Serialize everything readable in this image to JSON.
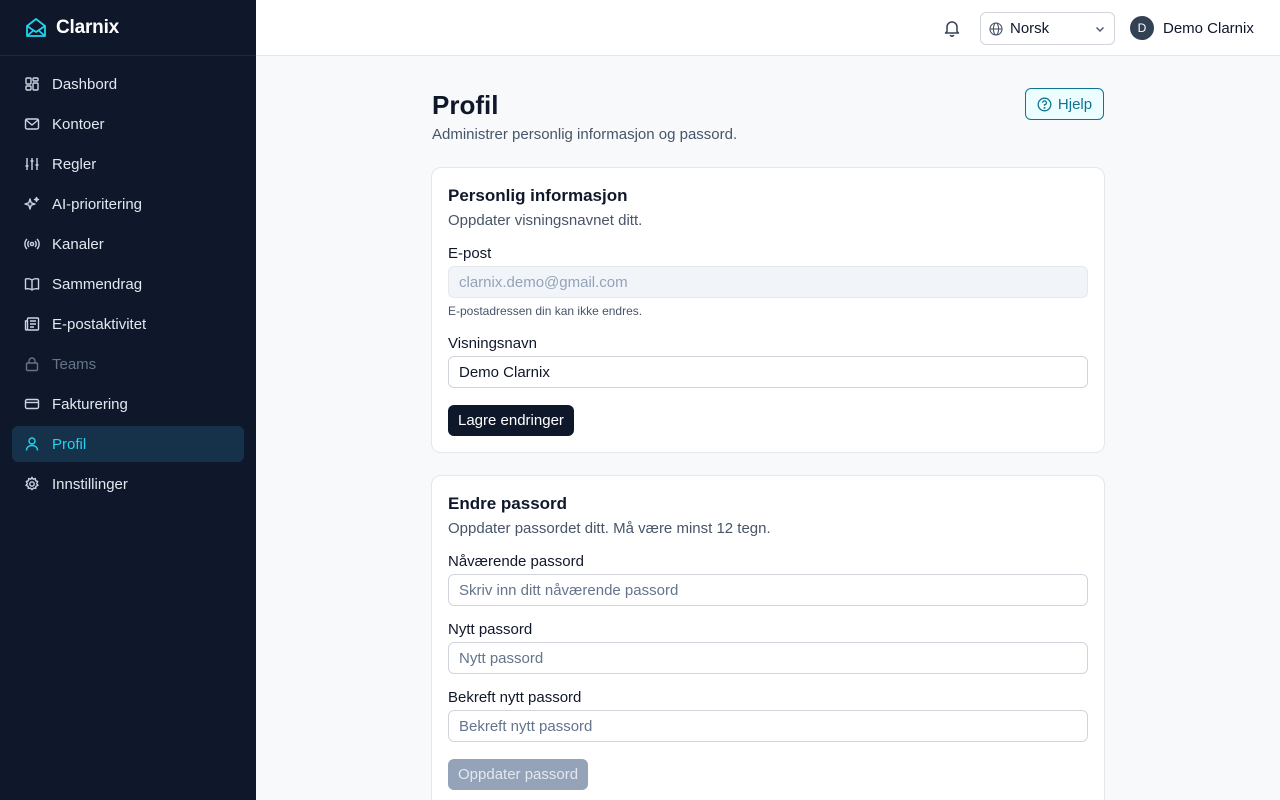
{
  "app": {
    "name": "Clarnix"
  },
  "sidebar": {
    "items": [
      {
        "label": "Dashbord",
        "icon": "dashboard-icon",
        "state": "normal"
      },
      {
        "label": "Kontoer",
        "icon": "mail-icon",
        "state": "normal"
      },
      {
        "label": "Regler",
        "icon": "sliders-icon",
        "state": "normal"
      },
      {
        "label": "AI-prioritering",
        "icon": "sparkles-icon",
        "state": "normal"
      },
      {
        "label": "Kanaler",
        "icon": "radio-icon",
        "state": "normal"
      },
      {
        "label": "Sammendrag",
        "icon": "book-icon",
        "state": "normal"
      },
      {
        "label": "E-postaktivitet",
        "icon": "newspaper-icon",
        "state": "normal"
      },
      {
        "label": "Teams",
        "icon": "lock-icon",
        "state": "disabled"
      },
      {
        "label": "Fakturering",
        "icon": "credit-card-icon",
        "state": "normal"
      },
      {
        "label": "Profil",
        "icon": "user-icon",
        "state": "active"
      },
      {
        "label": "Innstillinger",
        "icon": "gear-icon",
        "state": "normal"
      }
    ]
  },
  "topbar": {
    "language": "Norsk",
    "user_initial": "D",
    "user_name": "Demo Clarnix"
  },
  "main": {
    "title": "Profil",
    "subtitle": "Administrer personlig informasjon og passord.",
    "help_label": "Hjelp"
  },
  "personal": {
    "title": "Personlig informasjon",
    "description": "Oppdater visningsnavnet ditt.",
    "email_label": "E-post",
    "email_value": "clarnix.demo@gmail.com",
    "email_hint": "E-postadressen din kan ikke endres.",
    "name_label": "Visningsnavn",
    "name_value": "Demo Clarnix",
    "save_label": "Lagre endringer"
  },
  "password": {
    "title": "Endre passord",
    "description": "Oppdater passordet ditt. Må være minst 12 tegn.",
    "current_label": "Nåværende passord",
    "current_placeholder": "Skriv inn ditt nåværende passord",
    "new_label": "Nytt passord",
    "new_placeholder": "Nytt passord",
    "confirm_label": "Bekreft nytt passord",
    "confirm_placeholder": "Bekreft nytt passord",
    "submit_label": "Oppdater passord"
  },
  "colors": {
    "sidebar_bg": "#0f172a",
    "accent": "#22d3ee",
    "active_bg": "#16314a",
    "primary_button": "#0f172a"
  }
}
